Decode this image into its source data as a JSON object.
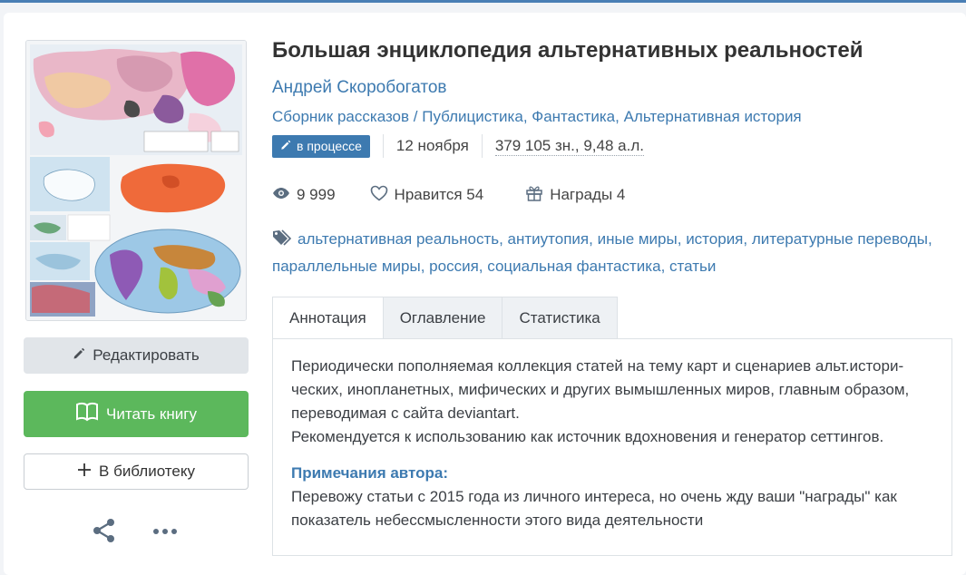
{
  "book": {
    "title": "Большая энциклопедия альтернативных реальностей",
    "author": "Андрей Скоробогатов",
    "genres": [
      "Сборник рассказов",
      "Публицистика",
      "Фантастика",
      "Альтернативная история"
    ],
    "status_badge": "в процессе",
    "date": "12 ноября",
    "size": "379 105 зн., 9,48 а.л.",
    "views": "9 999",
    "likes_label": "Нравится 54",
    "awards_label": "Награды 4",
    "tags": [
      "альтернативная реальность",
      "антиутопия",
      "иные миры",
      "история",
      "литературные переводы",
      "параллельные миры",
      "россия",
      "социальная фантастика",
      "статьи"
    ]
  },
  "actions": {
    "edit_label": "Редактировать",
    "read_label": "Читать книгу",
    "library_label": "В библиотеку"
  },
  "tabs": [
    {
      "label": "Аннотация",
      "active": true
    },
    {
      "label": "Оглавление",
      "active": false
    },
    {
      "label": "Статистика",
      "active": false
    }
  ],
  "annotation": {
    "line1": "Периодически пополняемая коллекция статей на тему карт и сценариев альт.истори-",
    "line2": "ческих, инопланетных, мифических и других вымышленных миров, главным образом,",
    "line3": "переводимая с сайта deviantart.",
    "line4": "Рекомендуется к использованию как источник вдохновения и генератор сеттингов.",
    "notes_title": "Примечания автора:",
    "notes1": "Перевожу статьи с 2015 года из личного интереса, но очень жду ваши \"награды\" как",
    "notes2": "показатель небессмысленности этого вида деятельности"
  },
  "icons": {
    "badge": "pencil-icon",
    "views": "eye-icon",
    "likes": "heart-icon",
    "awards": "gift-icon",
    "tags": "tags-icon",
    "edit": "pencil-icon",
    "read": "book-open-icon",
    "library": "plus-icon",
    "share": "share-icon",
    "more": "more-icon"
  },
  "colors": {
    "accent": "#3d7ab0",
    "read_button": "#5cb85c",
    "edit_button": "#e1e5e9"
  }
}
